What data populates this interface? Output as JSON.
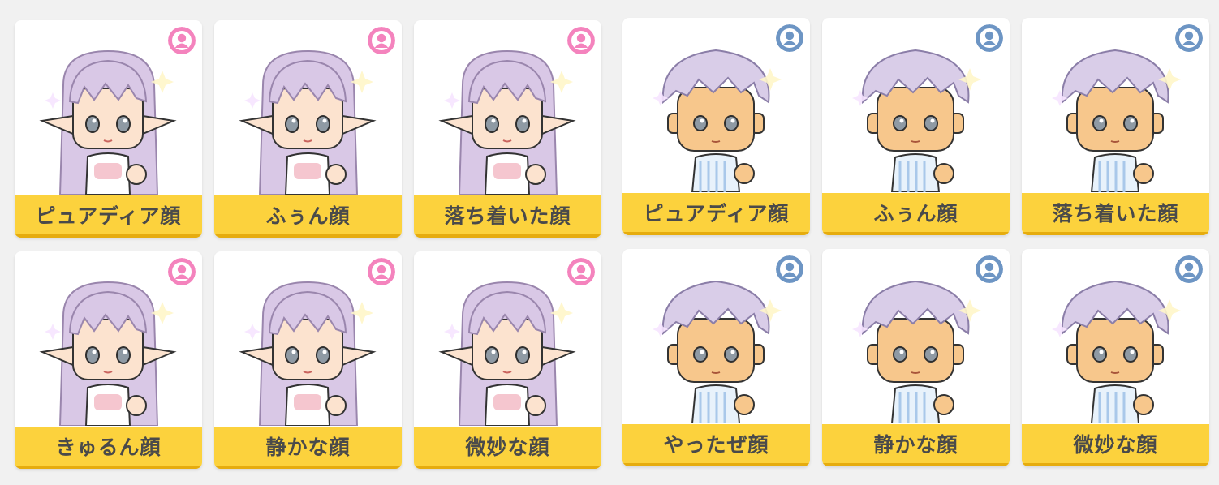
{
  "colors": {
    "female_badge": "#f483bd",
    "male_badge": "#6d95c4",
    "label_bg": "#fcd23d",
    "female_hair": "#d9c8e6",
    "male_hair": "#d9cde8",
    "skin": "#fce3cf",
    "male_skin": "#f7c78c"
  },
  "cards": [
    {
      "label": "ピュアディア顔",
      "gender": "female",
      "gender_icon": "female-user-icon"
    },
    {
      "label": "ふぅん顔",
      "gender": "female",
      "gender_icon": "female-user-icon"
    },
    {
      "label": "落ち着いた顔",
      "gender": "female",
      "gender_icon": "female-user-icon"
    },
    {
      "label": "ピュアディア顔",
      "gender": "male",
      "gender_icon": "male-user-icon"
    },
    {
      "label": "ふぅん顔",
      "gender": "male",
      "gender_icon": "male-user-icon"
    },
    {
      "label": "落ち着いた顔",
      "gender": "male",
      "gender_icon": "male-user-icon"
    },
    {
      "label": "きゅるん顔",
      "gender": "female",
      "gender_icon": "female-user-icon"
    },
    {
      "label": "静かな顔",
      "gender": "female",
      "gender_icon": "female-user-icon"
    },
    {
      "label": "微妙な顔",
      "gender": "female",
      "gender_icon": "female-user-icon"
    },
    {
      "label": "やったぜ顔",
      "gender": "male",
      "gender_icon": "male-user-icon"
    },
    {
      "label": "静かな顔",
      "gender": "male",
      "gender_icon": "male-user-icon"
    },
    {
      "label": "微妙な顔",
      "gender": "male",
      "gender_icon": "male-user-icon"
    }
  ]
}
